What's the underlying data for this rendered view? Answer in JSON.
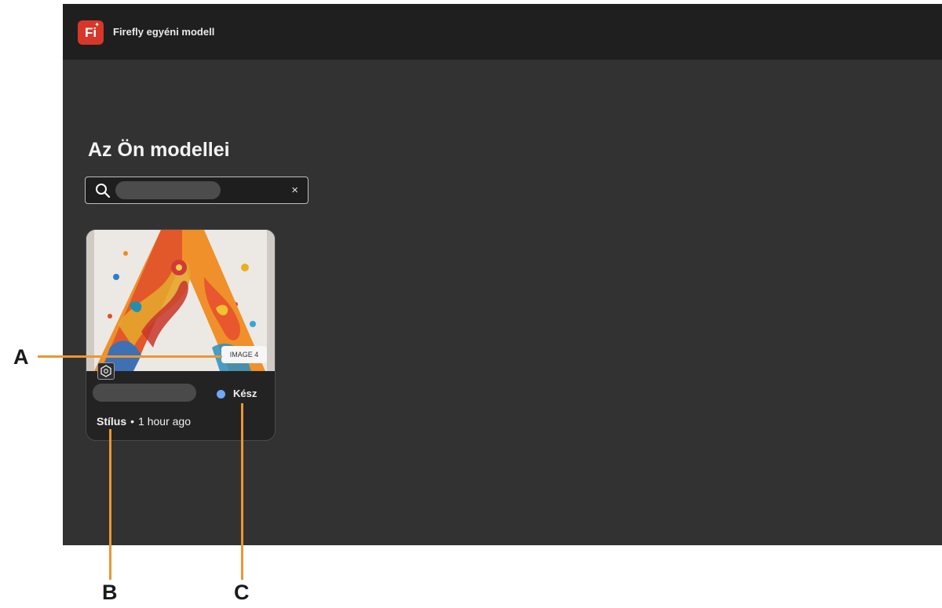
{
  "app": {
    "logo_text": "Fi",
    "title": "Firefly egyéni modell"
  },
  "page": {
    "title": "Az Ön modellei"
  },
  "search": {
    "value": "",
    "clear_label": "×"
  },
  "card": {
    "image_badge": "IMAGE 4",
    "status_label": "Kész",
    "status_color": "#6fa8f5",
    "model_type": "Stílus",
    "separator": "•",
    "time": "1 hour ago"
  },
  "callouts": {
    "a": "A",
    "b": "B",
    "c": "C",
    "color": "#e99734"
  },
  "colors": {
    "brand": "#d7372a",
    "app_background": "#323232",
    "topbar": "#1f1f1f"
  }
}
